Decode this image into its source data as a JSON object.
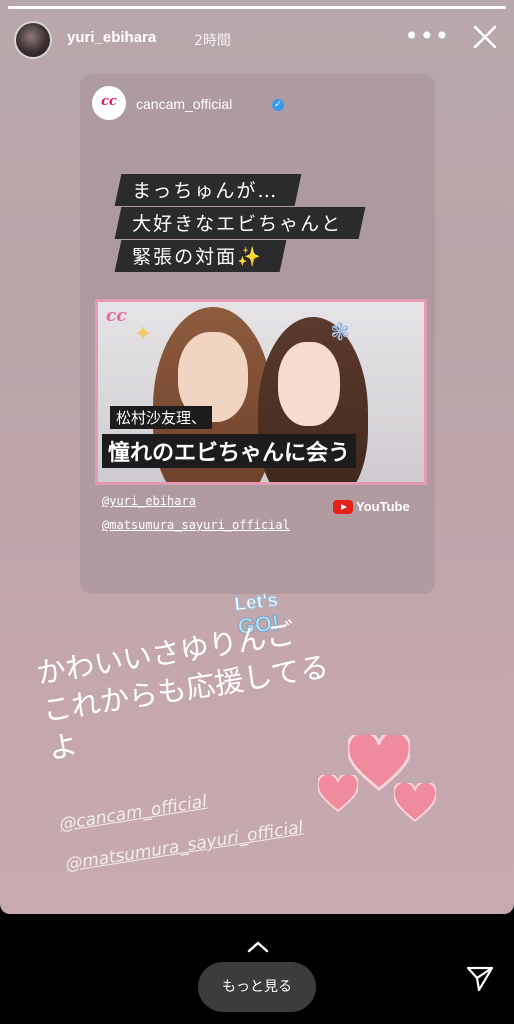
{
  "header": {
    "username": "yuri_ebihara",
    "time": "2時間",
    "more_icon": "more-horizontal-icon",
    "close_icon": "close-icon",
    "progress": 1.0
  },
  "card": {
    "account": "cancam_official",
    "logo_text": "cc",
    "headline": [
      "まっちゅんが…",
      "大好きなエビちゃんと",
      "緊張の対面✨"
    ],
    "thumbnail": {
      "brand": "cc",
      "small_text": "松村沙友理、",
      "big_text": "憧れのエビちゃんに会う"
    },
    "mentions": [
      "@yuri_ebihara",
      "@matsumura_sayuri_official"
    ],
    "youtube_label": "YouTube"
  },
  "sticker": {
    "line1": "Let's",
    "line2": "GO!"
  },
  "caption": [
    "かわいいさゆりんご",
    "これからも応援してる",
    "よ"
  ],
  "story_mentions": [
    "@cancam_official",
    "@matsumura_sayuri_official"
  ],
  "footer": {
    "more_label": "もっと見る"
  },
  "colors": {
    "accent_pink": "#e39ab4",
    "heart_pink": "#ef8b9c",
    "verified_blue": "#3897f0"
  }
}
